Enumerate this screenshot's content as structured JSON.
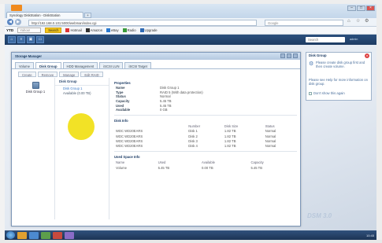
{
  "browser": {
    "tab_title": "Synology DiskStation - DiskStation",
    "new_tab_symbol": "+",
    "url": "http://192.168.0.101:5000/webman/index.cgi",
    "search_placeholder": "Google",
    "bookmark_ytd": "YTD",
    "yahoo_placeholder": "Yahoo!",
    "search_button": "Search",
    "bookmarks": [
      "Hotmail",
      "Amazon",
      "eBay",
      "Radio"
    ],
    "upgrade_label": "Upgrade"
  },
  "dsm": {
    "search_placeholder": "Search",
    "header_info": "admin"
  },
  "storage_manager": {
    "title": "Storage Manager",
    "tabs": [
      "Volume",
      "Disk Group",
      "HDD Management",
      "iSCSI LUN",
      "iSCSI Target"
    ],
    "active_tab": "Disk Group",
    "actions": [
      "Create",
      "Remove",
      "Manage",
      "Edit RAID"
    ],
    "left_item": "Disk Group 1",
    "tree_header": "Disk Group",
    "tree_items": [
      "Disk Group 1",
      "Available (0.00 TB)"
    ],
    "properties_title": "Properties",
    "properties": [
      {
        "key": "Name",
        "value": "Disk Group 1"
      },
      {
        "key": "Type",
        "value": "RAID 5 (With data protection)"
      },
      {
        "key": "Status",
        "value": "Normal"
      },
      {
        "key": "Capacity",
        "value": "5.45 TB"
      },
      {
        "key": "Used",
        "value": "5.45 TB"
      },
      {
        "key": "Available",
        "value": "0 GB"
      }
    ],
    "disk_info_title": "Disk Info",
    "disk_columns": [
      "",
      "Number",
      "Disk Size",
      "Status"
    ],
    "disks": [
      [
        "WDC WD20EARS",
        "Disk 1",
        "1.82 TB",
        "Normal"
      ],
      [
        "WDC WD20EARS",
        "Disk 2",
        "1.82 TB",
        "Normal"
      ],
      [
        "WDC WD20EARS",
        "Disk 3",
        "1.82 TB",
        "Normal"
      ],
      [
        "WDC WD20EARS",
        "Disk 4",
        "1.82 TB",
        "Normal"
      ]
    ],
    "space_title": "Used Space Info",
    "space_columns": [
      "Name",
      "Used",
      "Available",
      "Capacity"
    ],
    "space_rows": [
      [
        "Volume",
        "5.45 TB",
        "0.00 TB",
        "5.45 TB"
      ]
    ]
  },
  "help": {
    "title": "Disk Group",
    "text1": "Please create disk group first and then create volume.",
    "text2": "Please see Help for more information on disk group.",
    "checkbox_label": "Don't show this again"
  },
  "desktop": {
    "brand": "DSM 3.0"
  },
  "taskbar": {
    "clock": "10:45"
  }
}
